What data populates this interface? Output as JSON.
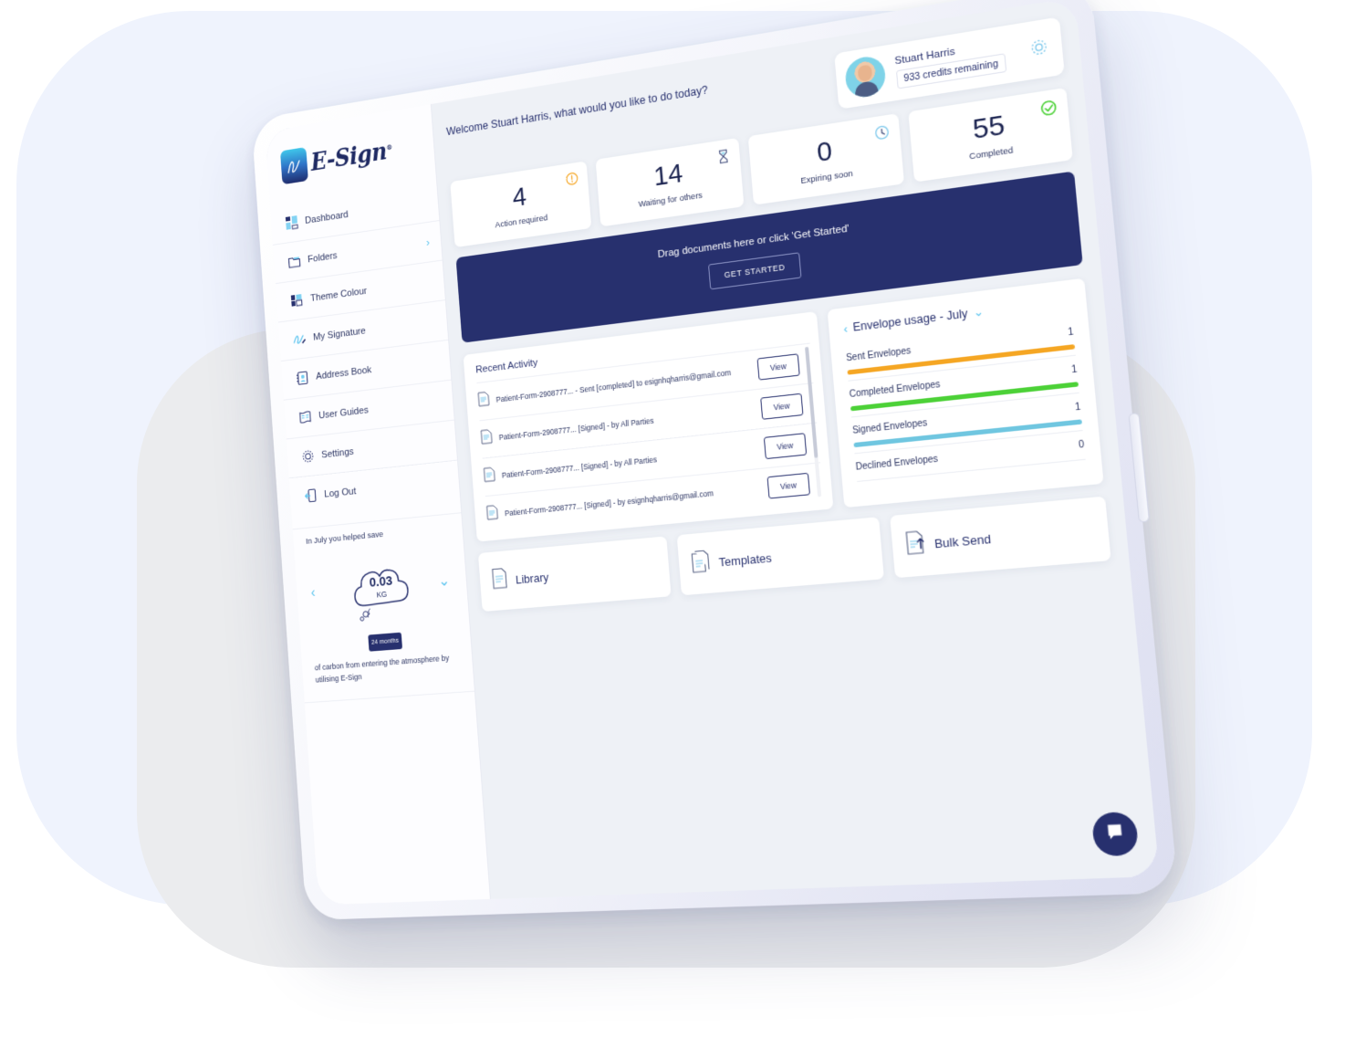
{
  "brand": {
    "name": "E-Sign",
    "trademark": "®",
    "logo_icon": "signature-logo-icon",
    "navy": "#27306e",
    "accent_blue": "#5bc4ef"
  },
  "sidebar": {
    "items": [
      {
        "label": "Dashboard",
        "icon": "dashboard-icon",
        "has_chevron": false
      },
      {
        "label": "Folders",
        "icon": "folder-icon",
        "has_chevron": true
      },
      {
        "label": "Theme Colour",
        "icon": "palette-icon",
        "has_chevron": false
      },
      {
        "label": "My Signature",
        "icon": "signature-icon",
        "has_chevron": false
      },
      {
        "label": "Address Book",
        "icon": "address-book-icon",
        "has_chevron": false
      },
      {
        "label": "User Guides",
        "icon": "book-icon",
        "has_chevron": false
      },
      {
        "label": "Settings",
        "icon": "gear-icon",
        "has_chevron": false
      },
      {
        "label": "Log Out",
        "icon": "logout-icon",
        "has_chevron": false
      }
    ],
    "carbon": {
      "top_text": "In July you helped save",
      "value": "0.03",
      "unit": "KG",
      "button_label": "24 months",
      "bottom_text": "of carbon from entering the atmosphere by utilising E-Sign",
      "prev_label": "‹",
      "next_label": "⌄"
    }
  },
  "header": {
    "welcome": "Welcome Stuart Harris, what would you like to do today?",
    "user_name": "Stuart Harris",
    "credits": "933 credits remaining",
    "settings_icon": "gear-icon",
    "avatar": "user-avatar"
  },
  "stats": [
    {
      "value": "4",
      "label": "Action required",
      "icon": "warning-icon",
      "color": "#f5a623"
    },
    {
      "value": "14",
      "label": "Waiting for others",
      "icon": "hourglass-icon",
      "color": "#7fc9ec"
    },
    {
      "value": "0",
      "label": "Expiring soon",
      "icon": "clock-icon",
      "color": "#7fc9ec"
    },
    {
      "value": "55",
      "label": "Completed",
      "icon": "check-circle-icon",
      "color": "#4cd137"
    }
  ],
  "drag_banner": {
    "text": "Drag documents here or click 'Get Started'",
    "button_label": "GET STARTED"
  },
  "recent_activity": {
    "title": "Recent Activity",
    "rows": [
      {
        "text": "Patient-Form-2908777... - Sent [completed] to esignhqharris@gmail.com",
        "icon": "document-icon",
        "action": "View"
      },
      {
        "text": "Patient-Form-2908777... [Signed] - by All Parties",
        "icon": "document-icon",
        "action": "View"
      },
      {
        "text": "Patient-Form-2908777... [Signed] - by All Parties",
        "icon": "document-icon",
        "action": "View"
      },
      {
        "text": "Patient-Form-2908777... [Signed] - by esignhqharris@gmail.com",
        "icon": "document-icon",
        "action": "View"
      }
    ]
  },
  "envelope_usage": {
    "title": "Envelope usage - July",
    "back_icon": "chevron-left-icon",
    "dropdown_icon": "chevron-down-icon",
    "rows": [
      {
        "label": "Sent Envelopes",
        "value": "1",
        "color": "#f5a623",
        "bar": true
      },
      {
        "label": "Completed Envelopes",
        "value": "1",
        "color": "#4cd137",
        "bar": true
      },
      {
        "label": "Signed Envelopes",
        "value": "1",
        "color": "#6fc6e0",
        "bar": true
      },
      {
        "label": "Declined Envelopes",
        "value": "0",
        "color": "#d8dbe4",
        "bar": false
      }
    ]
  },
  "quick_actions": [
    {
      "label": "Library",
      "icon": "library-document-icon"
    },
    {
      "label": "Templates",
      "icon": "templates-document-icon"
    },
    {
      "label": "Bulk Send",
      "icon": "bulk-send-icon"
    }
  ],
  "chat_widget": {
    "icon": "chat-bubble-icon"
  },
  "chart_data": {
    "type": "bar",
    "title": "Envelope usage - July",
    "categories": [
      "Sent Envelopes",
      "Completed Envelopes",
      "Signed Envelopes",
      "Declined Envelopes"
    ],
    "values": [
      1,
      1,
      1,
      0
    ],
    "colors": [
      "#f5a623",
      "#4cd137",
      "#6fc6e0",
      "#d8dbe4"
    ],
    "xlabel": "",
    "ylabel": "",
    "ylim": [
      0,
      1
    ],
    "legend": "none",
    "grid": false
  }
}
